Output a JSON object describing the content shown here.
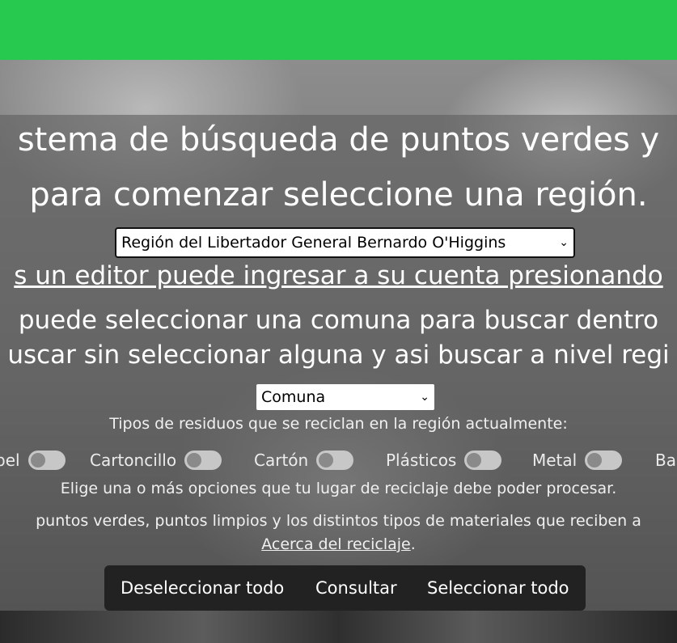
{
  "header": {
    "color": "#28c94f"
  },
  "hero": {
    "title_line1": "stema de búsqueda de puntos verdes y",
    "title_line2": "para comenzar seleccione una región.",
    "region_select": {
      "selected": "Región del Libertador General Bernardo O'Higgins"
    },
    "editor_link": "s un editor puede ingresar a su cuenta presionando",
    "comuna_info_line1": "puede seleccionar una comuna para buscar dentro",
    "comuna_info_line2": "uscar sin seleccionar alguna y asi buscar a nivel regi",
    "comuna_select": {
      "selected": "Comuna"
    },
    "residuos_heading": "Tipos de residuos que se reciclan en la región actualmente:",
    "toggles": [
      {
        "label": "pel",
        "checked": false
      },
      {
        "label": "Cartoncillo",
        "checked": false
      },
      {
        "label": "Cartón",
        "checked": false
      },
      {
        "label": "Plásticos",
        "checked": false
      },
      {
        "label": "Metal",
        "checked": false
      },
      {
        "label": "Ba",
        "checked": false
      }
    ],
    "hint": "Elige una o más opciones que tu lugar de reciclaje debe poder procesar.",
    "info_text": "puntos verdes, puntos limpios y los distintos tipos de materiales que reciben a",
    "about_link": "Acerca del reciclaje",
    "about_suffix": "."
  },
  "buttons": {
    "deselect_all": "Deseleccionar todo",
    "consult": "Consultar",
    "select_all": "Seleccionar todo"
  }
}
